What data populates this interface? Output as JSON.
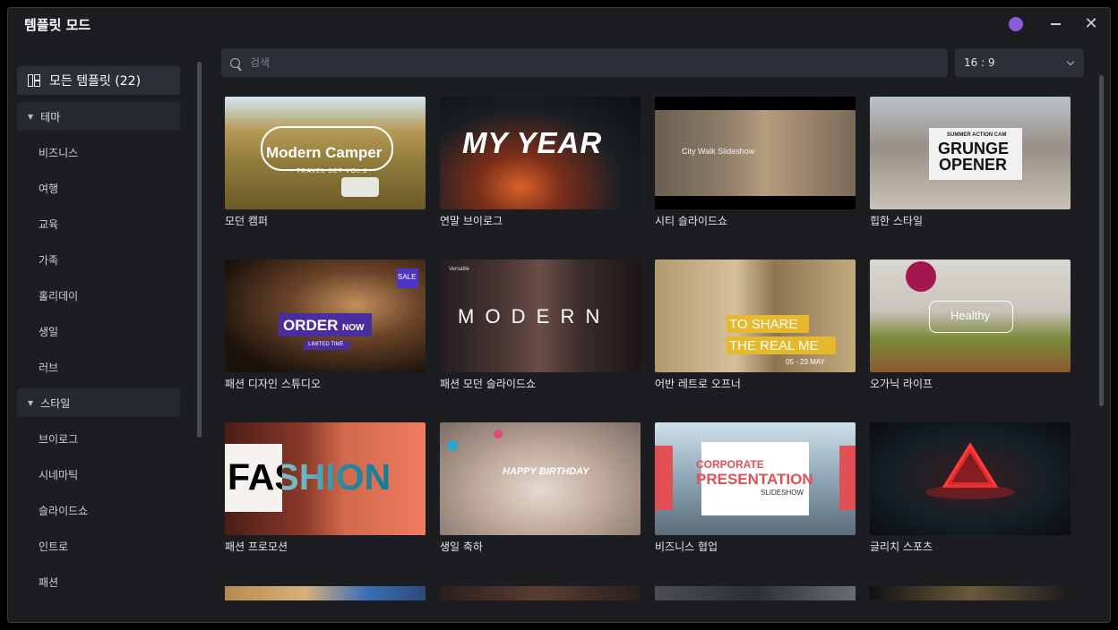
{
  "window": {
    "title": "템플릿 모드"
  },
  "sidebar": {
    "all_templates": "모든 템플릿 (22)",
    "groups": [
      {
        "label": "테마",
        "items": [
          "비즈니스",
          "여행",
          "교육",
          "가족",
          "홀리데이",
          "생일",
          "러브"
        ]
      },
      {
        "label": "스타일",
        "items": [
          "브이로그",
          "시네마틱",
          "슬라이드쇼",
          "인트로",
          "패션"
        ]
      }
    ]
  },
  "search": {
    "placeholder": "검색"
  },
  "aspect_ratio": {
    "selected": "16 : 9"
  },
  "templates": [
    {
      "name": "모던 캠퍼",
      "thumb_text": [
        "Modern Camper",
        "TRAVEL SET VOL.2"
      ]
    },
    {
      "name": "연말 브이로그",
      "thumb_text": [
        "MY YEAR"
      ]
    },
    {
      "name": "시티 슬라이드쇼",
      "thumb_text": [
        "City Walk Slideshow"
      ]
    },
    {
      "name": "힙한 스타일",
      "thumb_text": [
        "SUMMER ACTION CAM",
        "GRUNGE",
        "OPENER"
      ]
    },
    {
      "name": "패션 디자인 스튜디오",
      "thumb_text": [
        "ORDER",
        "NOW",
        "LIMITED TIME",
        "SALE"
      ]
    },
    {
      "name": "패션 모던 슬라이드쇼",
      "thumb_text": [
        "M O D E R N",
        "Versatile"
      ]
    },
    {
      "name": "어반 레트로 오프너",
      "thumb_text": [
        "TO SHARE",
        "THE REAL ME",
        "05 - 23 MAY"
      ]
    },
    {
      "name": "오가닉 라이프",
      "thumb_text": [
        "Healthy"
      ]
    },
    {
      "name": "패션 프로모션",
      "thumb_text": [
        "FASHION"
      ]
    },
    {
      "name": "생일 축하",
      "thumb_text": [
        "HAPPY BIRTHDAY"
      ]
    },
    {
      "name": "비즈니스 협업",
      "thumb_text": [
        "CORPORATE",
        "PRESENTATION",
        "SLIDESHOW"
      ]
    },
    {
      "name": "글리치 스포츠",
      "thumb_text": []
    }
  ],
  "colors": {
    "accent_avatar": "#8a5bd6",
    "bg": "#1b1d21",
    "panel": "#2c2f35"
  }
}
